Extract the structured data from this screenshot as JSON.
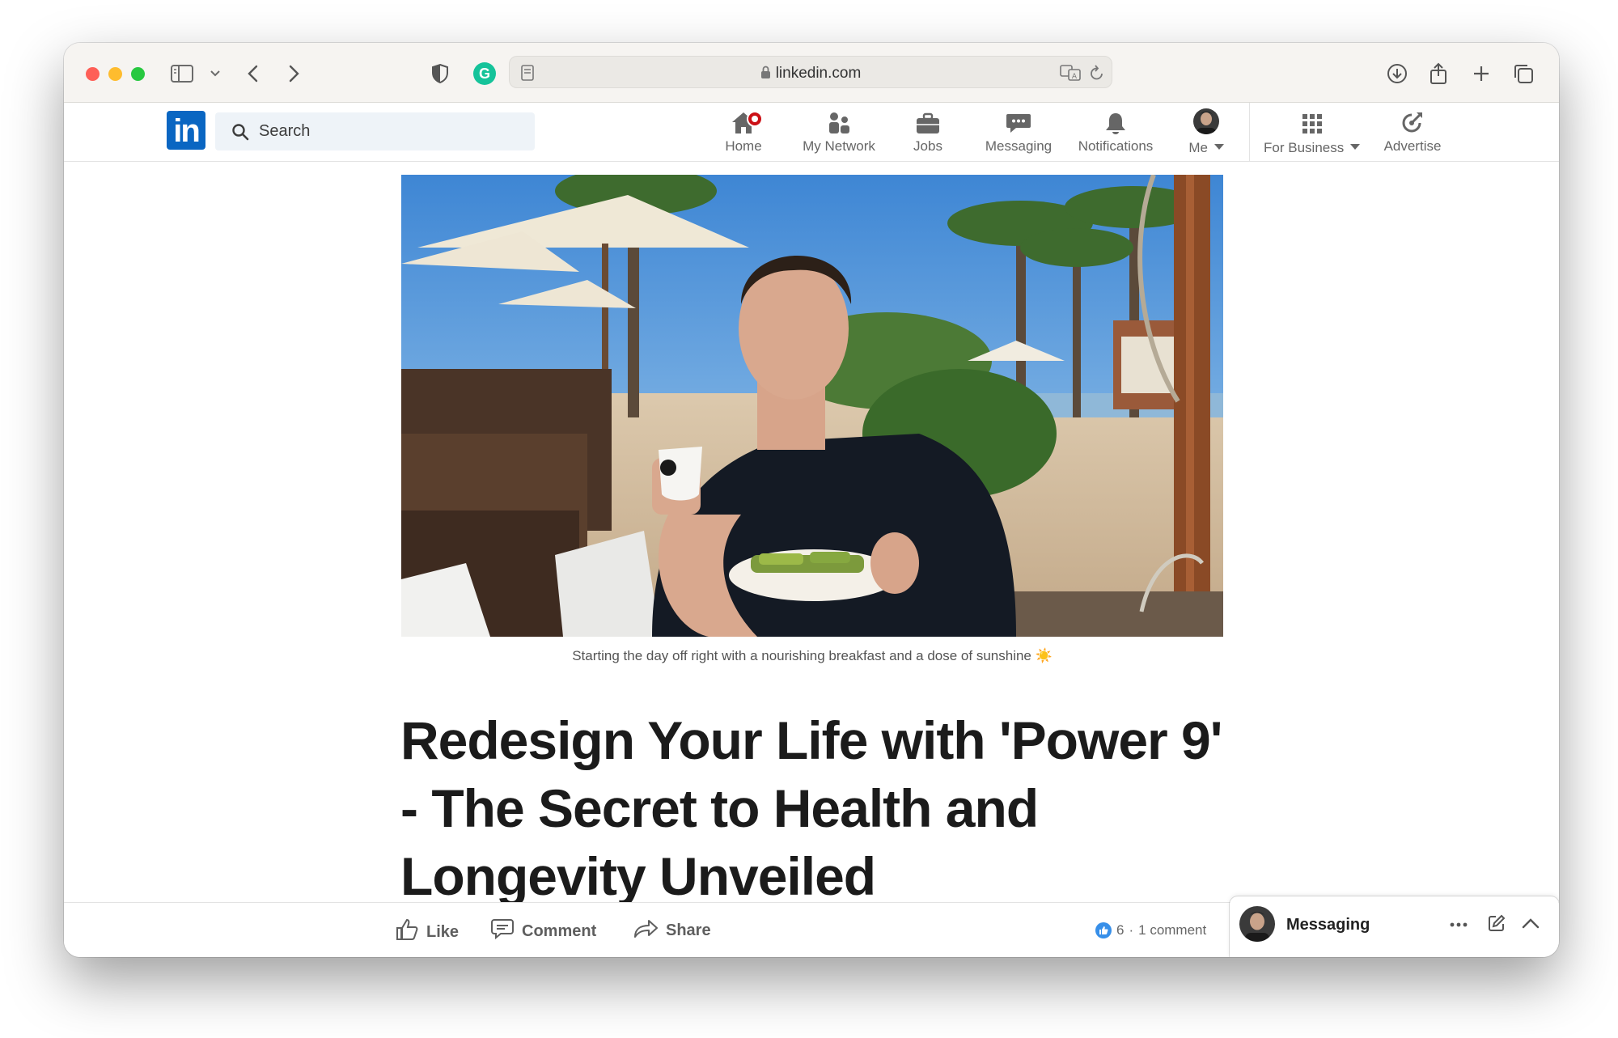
{
  "browser": {
    "url": "linkedin.com"
  },
  "linkedin": {
    "logo_text": "in",
    "search_placeholder": "Search",
    "nav": {
      "home": "Home",
      "network": "My Network",
      "jobs": "Jobs",
      "messaging": "Messaging",
      "notifications": "Notifications",
      "me": "Me",
      "business": "For Business",
      "advertise": "Advertise"
    }
  },
  "article": {
    "caption": "Starting the day off right with a nourishing breakfast and a dose of sunshine ☀️",
    "title_lines": [
      "Redesign Your Life with 'Power 9'",
      "- The Secret to Health and",
      "Longevity Unveiled"
    ]
  },
  "actions": {
    "like": "Like",
    "comment": "Comment",
    "share": "Share",
    "reaction_count": "6",
    "separator": "·",
    "comment_count": "1 comment"
  },
  "messaging_widget": {
    "label": "Messaging"
  },
  "colors": {
    "linkedin_blue": "#0a66c2",
    "notification_red": "#cc1016",
    "like_blue": "#378fe9"
  }
}
